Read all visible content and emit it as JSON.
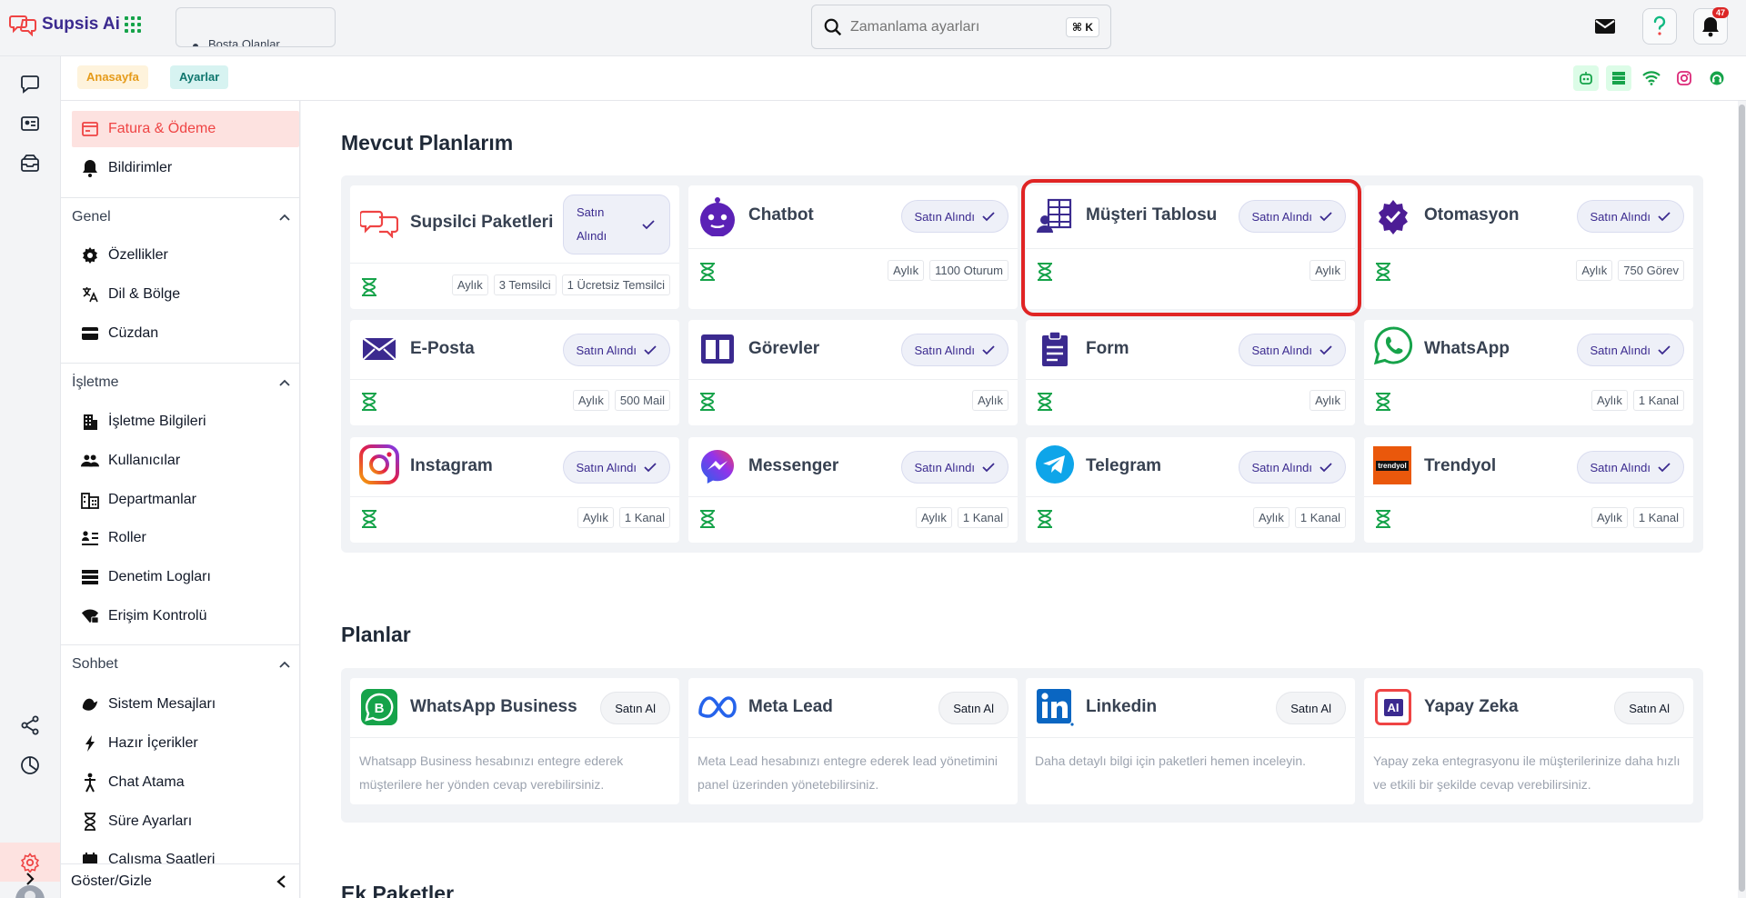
{
  "app": {
    "name": "Supsis Ai"
  },
  "top_tab": {
    "label": "Bosta Olanlar"
  },
  "search": {
    "placeholder": "Zamanlama ayarları",
    "shortcut": "⌘ K"
  },
  "notifications": {
    "count": "47"
  },
  "breadcrumb": {
    "home": "Anasayfa",
    "current": "Ayarlar"
  },
  "sidebar": {
    "top_items": [
      {
        "label": "Fatura & Ödeme",
        "icon": "invoice-icon",
        "active": true
      },
      {
        "label": "Bildirimler",
        "icon": "bell-icon"
      }
    ],
    "sections": [
      {
        "title": "Genel",
        "items": [
          {
            "label": "Özellikler",
            "icon": "gear-icon"
          },
          {
            "label": "Dil & Bölge",
            "icon": "translate-icon"
          },
          {
            "label": "Cüzdan",
            "icon": "wallet-icon"
          }
        ]
      },
      {
        "title": "İşletme",
        "items": [
          {
            "label": "İşletme Bilgileri",
            "icon": "building-icon"
          },
          {
            "label": "Kullanıcılar",
            "icon": "users-icon"
          },
          {
            "label": "Departmanlar",
            "icon": "departments-icon"
          },
          {
            "label": "Roller",
            "icon": "roles-icon"
          },
          {
            "label": "Denetim Logları",
            "icon": "list-icon"
          },
          {
            "label": "Erişim Kontrolü",
            "icon": "access-icon"
          }
        ]
      },
      {
        "title": "Sohbet",
        "items": [
          {
            "label": "Sistem Mesajları",
            "icon": "system-messages-icon"
          },
          {
            "label": "Hazır İçerikler",
            "icon": "bolt-icon"
          },
          {
            "label": "Chat Atama",
            "icon": "assign-icon"
          },
          {
            "label": "Süre Ayarları",
            "icon": "hourglass-icon"
          },
          {
            "label": "Çalışma Saatleri",
            "icon": "calendar-icon"
          }
        ]
      }
    ],
    "footer": "Göster/Gizle"
  },
  "current_plans": {
    "title": "Mevcut Planlarım",
    "owned_label": "Satın Alındı",
    "cards": [
      {
        "name": "Supsilci Paketleri",
        "owned": "Satın Alındı",
        "tags": [
          "Aylık",
          "3 Temsilci",
          "1 Ücretsiz Temsilci"
        ],
        "icon": "supsis-logo-icon"
      },
      {
        "name": "Chatbot",
        "owned": "Satın Alındı",
        "tags": [
          "Aylık",
          "1100 Oturum"
        ],
        "icon": "robot-icon"
      },
      {
        "name": "Müşteri Tablosu",
        "owned": "Satın Alındı",
        "tags": [
          "Aylık"
        ],
        "icon": "customer-table-icon"
      },
      {
        "name": "Otomasyon",
        "owned": "Satın Alındı",
        "tags": [
          "Aylık",
          "750 Görev"
        ],
        "icon": "automation-icon"
      },
      {
        "name": "E-Posta",
        "owned": "Satın Alındı",
        "tags": [
          "Aylık",
          "500 Mail"
        ],
        "icon": "envelope-icon"
      },
      {
        "name": "Görevler",
        "owned": "Satın Alındı",
        "tags": [
          "Aylık"
        ],
        "icon": "kanban-icon"
      },
      {
        "name": "Form",
        "owned": "Satın Alındı",
        "tags": [
          "Aylık"
        ],
        "icon": "clipboard-icon"
      },
      {
        "name": "WhatsApp",
        "owned": "Satın Alındı",
        "tags": [
          "Aylık",
          "1 Kanal"
        ],
        "icon": "whatsapp-icon"
      },
      {
        "name": "Instagram",
        "owned": "Satın Alındı",
        "tags": [
          "Aylık",
          "1 Kanal"
        ],
        "icon": "instagram-icon"
      },
      {
        "name": "Messenger",
        "owned": "Satın Alındı",
        "tags": [
          "Aylık",
          "1 Kanal"
        ],
        "icon": "messenger-icon"
      },
      {
        "name": "Telegram",
        "owned": "Satın Alındı",
        "tags": [
          "Aylık",
          "1 Kanal"
        ],
        "icon": "telegram-icon"
      },
      {
        "name": "Trendyol",
        "owned": "Satın Alındı",
        "tags": [
          "Aylık",
          "1 Kanal"
        ],
        "icon": "trendyol-icon",
        "logo_text": "trendyol"
      }
    ]
  },
  "plans": {
    "title": "Planlar",
    "cards": [
      {
        "name": "WhatsApp Business",
        "buy": "Satın Al",
        "desc": "Whatsapp Business hesabınızı entegre ederek müşterilere her yönden cevap verebilirsiniz.",
        "icon": "whatsapp-business-icon"
      },
      {
        "name": "Meta Lead",
        "buy": "Satın Al",
        "desc": "Meta Lead hesabınızı entegre ederek lead yönetimini panel üzerinden yönetebilirsiniz.",
        "icon": "meta-icon"
      },
      {
        "name": "Linkedin",
        "buy": "Satın Al",
        "desc": "Daha detaylı bilgi için paketleri hemen inceleyin.",
        "icon": "linkedin-icon"
      },
      {
        "name": "Yapay Zeka",
        "buy": "Satın Al",
        "desc": "Yapay zeka entegrasyonu ile müşterilerinize daha hızlı ve etkili bir şekilde cevap verebilirsiniz.",
        "icon": "ai-chip-icon",
        "logo_text": "AI"
      }
    ]
  },
  "extra_packages": {
    "title": "Ek Paketler"
  },
  "colors": {
    "brand": "#3b2a8f",
    "accent": "#ef4444",
    "highlight": "#e02424",
    "success": "#16a34a"
  }
}
